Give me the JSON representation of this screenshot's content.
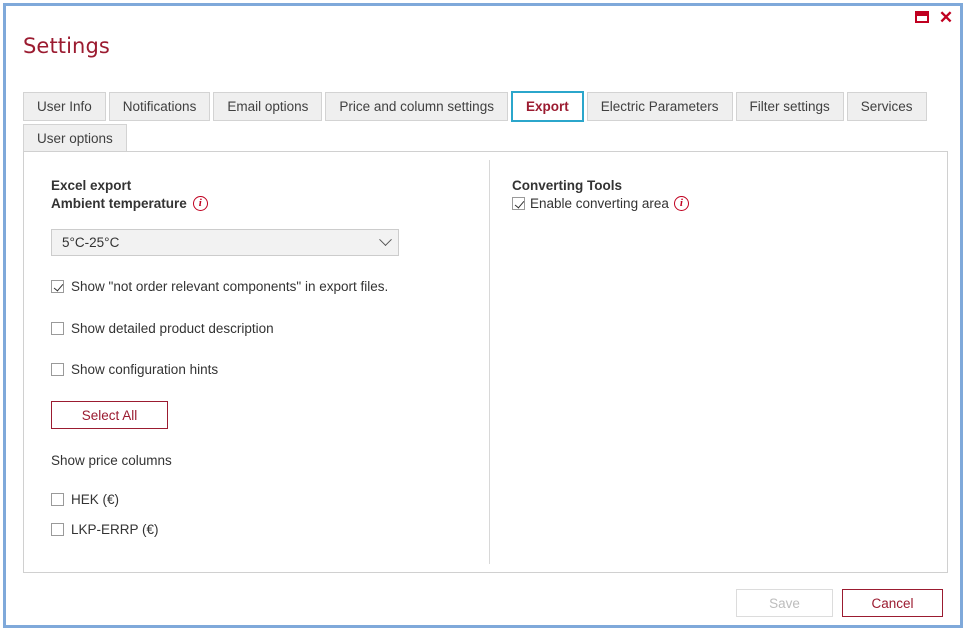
{
  "window": {
    "title": "Settings",
    "controls": {
      "restore_label": "Restore",
      "close_label": "✕"
    },
    "accent_color": "#9b1b30",
    "border_color": "#7fa9da",
    "active_tab_border_color": "#2ba6cb"
  },
  "tabs": {
    "row1": [
      {
        "label": "User Info",
        "active": false
      },
      {
        "label": "Notifications",
        "active": false
      },
      {
        "label": "Email options",
        "active": false
      },
      {
        "label": "Price and column settings",
        "active": false
      },
      {
        "label": "Export",
        "active": true
      },
      {
        "label": "Electric Parameters",
        "active": false
      },
      {
        "label": "Filter settings",
        "active": false
      },
      {
        "label": "Services",
        "active": false
      }
    ],
    "row2": [
      {
        "label": "User options",
        "active": false
      }
    ]
  },
  "left_panel": {
    "section_title": "Excel export",
    "field_label": "Ambient temperature",
    "field_info_icon": "info-icon",
    "temperature_select": {
      "value": "5°C-25°C",
      "options": [
        "5°C-25°C"
      ]
    },
    "checkboxes": [
      {
        "label": "Show \"not order relevant components\" in export files.",
        "checked": true
      },
      {
        "label": "Show detailed product description",
        "checked": false
      },
      {
        "label": "Show configuration hints",
        "checked": false
      }
    ],
    "select_all_button": "Select All",
    "price_columns_label": "Show price columns",
    "price_columns": [
      {
        "label": "HEK (€)",
        "checked": false
      },
      {
        "label": "LKP-ERRP (€)",
        "checked": false
      }
    ]
  },
  "right_panel": {
    "section_title": "Converting Tools",
    "checkbox": {
      "label": "Enable converting area",
      "checked": true
    },
    "info_icon": "info-icon"
  },
  "footer": {
    "save_label": "Save",
    "save_disabled": true,
    "cancel_label": "Cancel"
  }
}
